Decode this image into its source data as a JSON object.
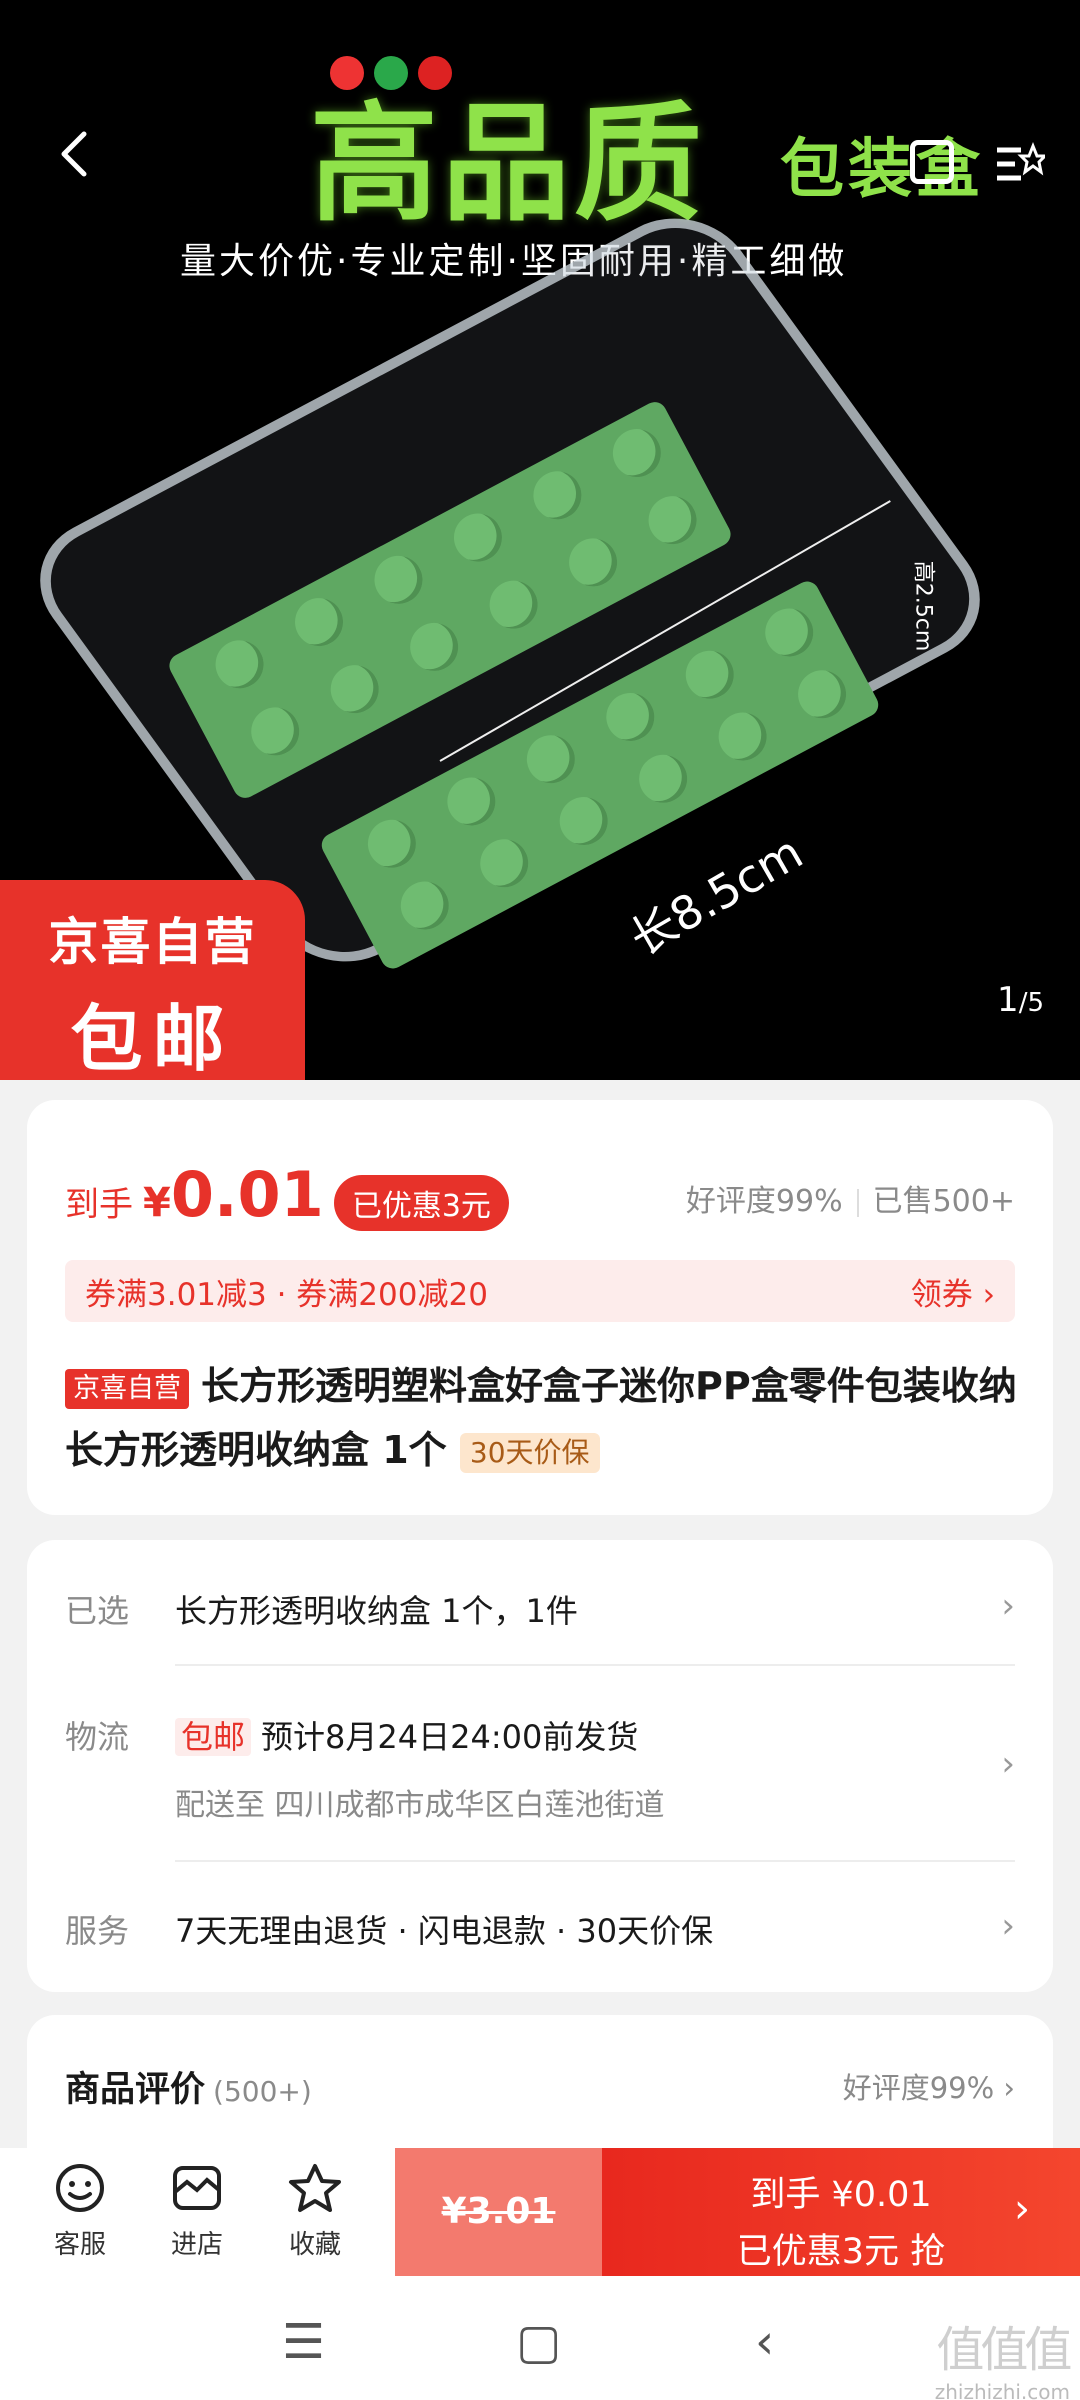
{
  "hero": {
    "title": "高品质",
    "title_small": "包装盒",
    "tagline": "量大价优·专业定制·坚固耐用·精工细做",
    "dim_length": "长8.5cm",
    "dim_height": "高2.5cm",
    "pager_current": "1",
    "pager_total": "/5",
    "badge_line1": "京喜自营",
    "badge_line2": "包邮"
  },
  "price": {
    "prefix": "到手",
    "yen": "¥",
    "amount": "0.01",
    "discount_badge": "已优惠3元",
    "rating": "好评度99%",
    "sold": "已售500+"
  },
  "coupons": {
    "text": "券满3.01减3 · 券满200减20",
    "get_label": "领券 ›"
  },
  "product": {
    "tag": "京喜自营",
    "title": "长方形透明塑料盒好盒子迷你PP盒零件包装收纳 长方形透明收纳盒 1个",
    "price_protect": "30天价保"
  },
  "options": {
    "selected_key": "已选",
    "selected_value": "长方形透明收纳盒 1个，1件",
    "logistics_key": "物流",
    "logistics_tag": "包邮",
    "logistics_value": "预计8月24日24:00前发货",
    "delivery_to": "配送至  四川成都市成华区白莲池街道",
    "service_key": "服务",
    "service_value": "7天无理由退货 · 闪电退款 · 30天价保"
  },
  "reviews": {
    "title": "商品评价",
    "count": "(500+)",
    "rating": "好评度99% ›"
  },
  "bottom_bar": {
    "service_label": "客服",
    "store_label": "进店",
    "fav_label": "收藏",
    "original_price": "¥3.01",
    "buy_line1": "到手 ¥0.01",
    "buy_line2": "已优惠3元 抢"
  },
  "watermark": {
    "mark": "值值值",
    "site": "zhizhizhi.com"
  },
  "colors": {
    "accent": "#e7322a",
    "hero_green": "#8fe24a",
    "brick_green": "#5fa862"
  }
}
